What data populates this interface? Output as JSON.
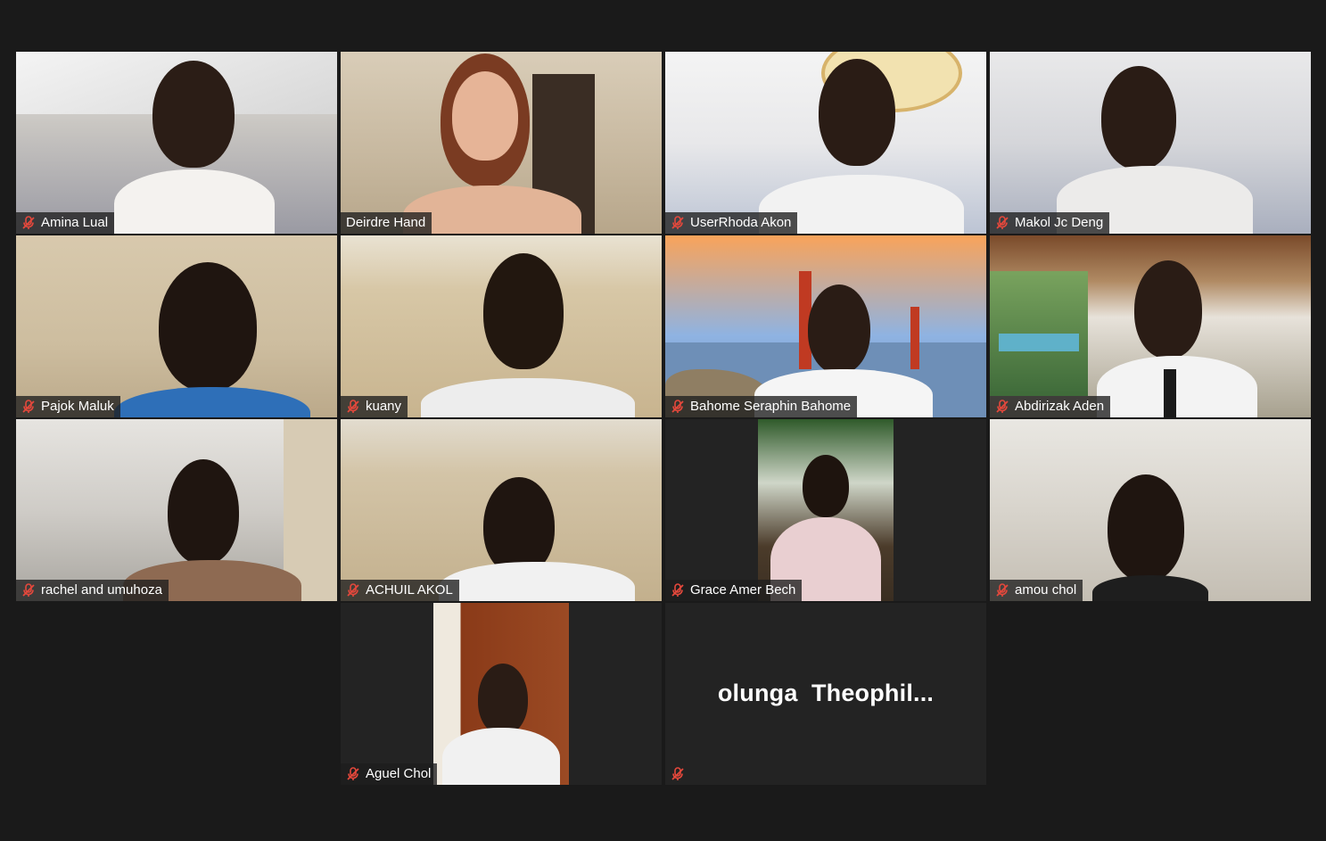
{
  "meeting": {
    "participants": [
      {
        "name": "Amina Lual",
        "muted": true,
        "active": false
      },
      {
        "name": "Deirdre Hand",
        "muted": false,
        "active": false
      },
      {
        "name": "UserRhoda Akon",
        "muted": true,
        "active": false
      },
      {
        "name": "Makol Jc Deng",
        "muted": true,
        "active": false
      },
      {
        "name": "Pajok Maluk",
        "muted": true,
        "active": false
      },
      {
        "name": "kuany",
        "muted": true,
        "active": true
      },
      {
        "name": "Bahome Seraphin Bahome",
        "muted": true,
        "active": false
      },
      {
        "name": "Abdirizak Aden",
        "muted": true,
        "active": false
      },
      {
        "name": "rachel and umuhoza",
        "muted": true,
        "active": false
      },
      {
        "name": "ACHUIL AKOL",
        "muted": true,
        "active": false
      },
      {
        "name": "Grace Amer Bech",
        "muted": true,
        "active": false
      },
      {
        "name": "amou chol",
        "muted": true,
        "active": false
      },
      {
        "name": "Aguel Chol",
        "muted": true,
        "active": false
      }
    ],
    "video_off_participant": {
      "display_name": "olunga  Theophil...",
      "muted": true
    }
  },
  "colors": {
    "background": "#1a1a1a",
    "tile_empty": "#232323",
    "active_speaker_border": "#e6eb9a",
    "muted_icon": "#e5483c",
    "nametag_text": "#ffffff"
  },
  "icons": {
    "muted": "microphone-muted-icon"
  }
}
